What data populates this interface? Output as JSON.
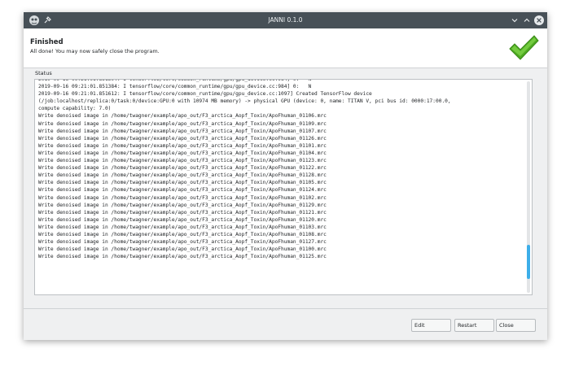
{
  "window": {
    "title": "JANNI 0.1.0"
  },
  "header": {
    "title": "Finished",
    "subtitle": "All done! You may now safely close the program.",
    "status_icon": "checkmark-icon",
    "status_color": "#5cb82e"
  },
  "status": {
    "label": "Status",
    "scroll_position": 0.92,
    "scroll_visible_fraction": 0.16,
    "lines": [
      "2019-09-16 09:21:01.851304: I tensorflow/core/common_runtime/gpu/gpu_device.cc:984] 0:   N",
      "2019-09-16 09:21:01.851384: I tensorflow/core/common_runtime/gpu/gpu_device.cc:984] 0:   N",
      "2019-09-16 09:21:01.851612: I tensorflow/core/common_runtime/gpu/gpu_device.cc:1097] Created TensorFlow device",
      "(/job:localhost/replica:0/task:0/device:GPU:0 with 10974 MB memory) -> physical GPU (device: 0, name: TITAN V, pci bus id: 0000:17:00.0,",
      "compute capability: 7.0)",
      "Write denoised image in /home/twagner/example/apo_out/F3_arctica_Aopf_Toxin/ApoFhuman_01106.mrc",
      "Write denoised image in /home/twagner/example/apo_out/F3_arctica_Aopf_Toxin/ApoFhuman_01109.mrc",
      "Write denoised image in /home/twagner/example/apo_out/F3_arctica_Aopf_Toxin/ApoFhuman_01107.mrc",
      "Write denoised image in /home/twagner/example/apo_out/F3_arctica_Aopf_Toxin/ApoFhuman_01126.mrc",
      "Write denoised image in /home/twagner/example/apo_out/F3_arctica_Aopf_Toxin/ApoFhuman_01101.mrc",
      "Write denoised image in /home/twagner/example/apo_out/F3_arctica_Aopf_Toxin/ApoFhuman_01104.mrc",
      "Write denoised image in /home/twagner/example/apo_out/F3_arctica_Aopf_Toxin/ApoFhuman_01123.mrc",
      "Write denoised image in /home/twagner/example/apo_out/F3_arctica_Aopf_Toxin/ApoFhuman_01122.mrc",
      "Write denoised image in /home/twagner/example/apo_out/F3_arctica_Aopf_Toxin/ApoFhuman_01128.mrc",
      "Write denoised image in /home/twagner/example/apo_out/F3_arctica_Aopf_Toxin/ApoFhuman_01105.mrc",
      "Write denoised image in /home/twagner/example/apo_out/F3_arctica_Aopf_Toxin/ApoFhuman_01124.mrc",
      "Write denoised image in /home/twagner/example/apo_out/F3_arctica_Aopf_Toxin/ApoFhuman_01102.mrc",
      "Write denoised image in /home/twagner/example/apo_out/F3_arctica_Aopf_Toxin/ApoFhuman_01129.mrc",
      "Write denoised image in /home/twagner/example/apo_out/F3_arctica_Aopf_Toxin/ApoFhuman_01121.mrc",
      "Write denoised image in /home/twagner/example/apo_out/F3_arctica_Aopf_Toxin/ApoFhuman_01120.mrc",
      "Write denoised image in /home/twagner/example/apo_out/F3_arctica_Aopf_Toxin/ApoFhuman_01103.mrc",
      "Write denoised image in /home/twagner/example/apo_out/F3_arctica_Aopf_Toxin/ApoFhuman_01108.mrc",
      "Write denoised image in /home/twagner/example/apo_out/F3_arctica_Aopf_Toxin/ApoFhuman_01127.mrc",
      "Write denoised image in /home/twagner/example/apo_out/F3_arctica_Aopf_Toxin/ApoFhuman_01100.mrc",
      "Write denoised image in /home/twagner/example/apo_out/F3_arctica_Aopf_Toxin/ApoFhuman_01125.mrc"
    ]
  },
  "buttons": {
    "edit": "Edit",
    "restart": "Restart",
    "close": "Close"
  },
  "titlebar_icons": [
    "app-icon",
    "pin-icon",
    "minimize-icon",
    "maximize-icon",
    "close-icon"
  ]
}
